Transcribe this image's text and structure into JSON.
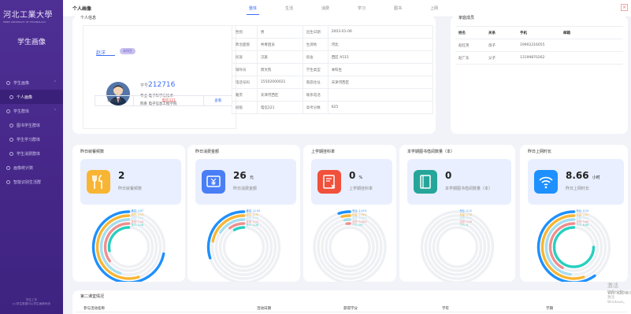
{
  "sidebar": {
    "logo_text": "河北工業大學",
    "logo_sub": "HEBEI UNIVERSITY OF TECHNOLOGY",
    "system_title": "学生画像",
    "menu": [
      {
        "label": "学生画像",
        "expanded": true
      },
      {
        "label": "个人画像",
        "active": true
      },
      {
        "label": "学生群体",
        "expanded": true
      },
      {
        "label": "图书学生群体"
      },
      {
        "label": "学生学习群体"
      },
      {
        "label": "学生消费群体"
      },
      {
        "label": "画像统计数"
      },
      {
        "label": "智能识别生活群"
      }
    ],
    "footer_line1": "学生工作",
    "footer_line2": "(c)学生数据中心学生画像系统"
  },
  "topbar": {
    "title": "个人画像",
    "tabs": [
      "整体",
      "生活",
      "消费",
      "学习",
      "图书",
      "上网"
    ],
    "active_tab": "整体",
    "close_icon": "close-icon"
  },
  "student": {
    "section_title": "个人信息",
    "name": "赵洋",
    "tag": "本科生",
    "id_number": "212716",
    "major": "电子科学与技术",
    "college": "电子信息工程学院",
    "ctrl_label": "相似分值",
    "ctrl_value": "电信221",
    "ctrl_button": "查看",
    "table": [
      [
        "性别",
        "男",
        "出生日期",
        "2003-01-06"
      ],
      [
        "政治面貌",
        "共青团员",
        "生源地",
        "河北"
      ],
      [
        "民族",
        "汉族",
        "宿舍",
        "西区 A515"
      ],
      [
        "辅导员",
        "周文凯",
        "学生类型",
        "本科生"
      ],
      [
        "电话号码",
        "15502000021",
        "家庭住址",
        "天津河西区"
      ],
      [
        "籍贯",
        "天津河西区",
        "联系电话",
        ""
      ],
      [
        "班级",
        "电信221",
        "高考分数",
        "625"
      ]
    ]
  },
  "family": {
    "section_title": "家庭成员",
    "headers": [
      "姓名",
      "关系",
      "手机",
      "邮箱"
    ],
    "rows": [
      [
        "赵红英",
        "母子",
        "19902216055",
        ""
      ],
      [
        "赵广东",
        "父子",
        "13199870262",
        ""
      ]
    ]
  },
  "metrics": [
    {
      "title": "昨日就餐频数",
      "value": "2",
      "unit": "",
      "label": "昨日就餐频数",
      "icon": "utensils-icon",
      "color": "#f8b534",
      "legend": [
        "食堂: 1.67",
        "超市: 1.59",
        "浴室: 1.41",
        "其他: 1.26",
        "总人: 1.08"
      ]
    },
    {
      "title": "昨日消费金额",
      "value": "26",
      "unit": "元",
      "label": "昨日消费金额",
      "icon": "yen-card-icon",
      "color": "#4a7ef6",
      "legend": [
        "食堂: 11.94",
        "超市: 8.95",
        "浴室: 6.41",
        "其他: 3.10",
        "总人: 2.38"
      ]
    },
    {
      "title": "上学期挂科率",
      "value": "0",
      "unit": "%",
      "label": "上学期挂科率",
      "icon": "fail-doc-icon",
      "color": "#f1503b",
      "legend": [
        "专业: 2.41%",
        "年级: 1.94%",
        "学院: 1.02%",
        "全校: 0.38%",
        "个人: 0%"
      ]
    },
    {
      "title": "本学期图书借阅数量（本）",
      "value": "0",
      "unit": "",
      "label": "本学期图书借阅数量（本）",
      "icon": "book-icon",
      "color": "#26a69a",
      "legend": [
        "专业: 0.12",
        "年级: 0.18",
        "学院: 0.21",
        "全校: 0.26",
        "个人: 0"
      ]
    },
    {
      "title": "昨日上网时长",
      "value": "8.66",
      "unit": "小时",
      "label": "昨日上网时长",
      "icon": "wifi-icon",
      "color": "#1e90ff",
      "legend": [
        "专业: 5.24",
        "年级: 4.81",
        "学院: 4.13",
        "全校: 3.66",
        "个人: 8.66"
      ]
    }
  ],
  "ring_colors": [
    "#1e90ff",
    "#f8b534",
    "#a6ddef",
    "#ef8f8f",
    "#26d0c0"
  ],
  "metric_ring_fractions": [
    [
      0.72,
      0.55,
      0.45,
      0.35,
      0.28
    ],
    [
      0.3,
      0.22,
      0.16,
      0.1,
      0.08
    ],
    [
      0.05,
      0.04,
      0.03,
      0.02,
      0.0
    ],
    [
      0.0,
      0.0,
      0.0,
      0.0,
      0.0
    ],
    [
      0.6,
      0.55,
      0.48,
      0.42,
      0.75
    ]
  ],
  "semester": {
    "section_title": "第二课堂情况",
    "headers": [
      "参与活动名称",
      "活动日期",
      "获得学分",
      "学年",
      "学期"
    ]
  },
  "watermark": {
    "line1": "激活 Windows",
    "line2": "转到\"设置\"以激活 Windows。"
  }
}
